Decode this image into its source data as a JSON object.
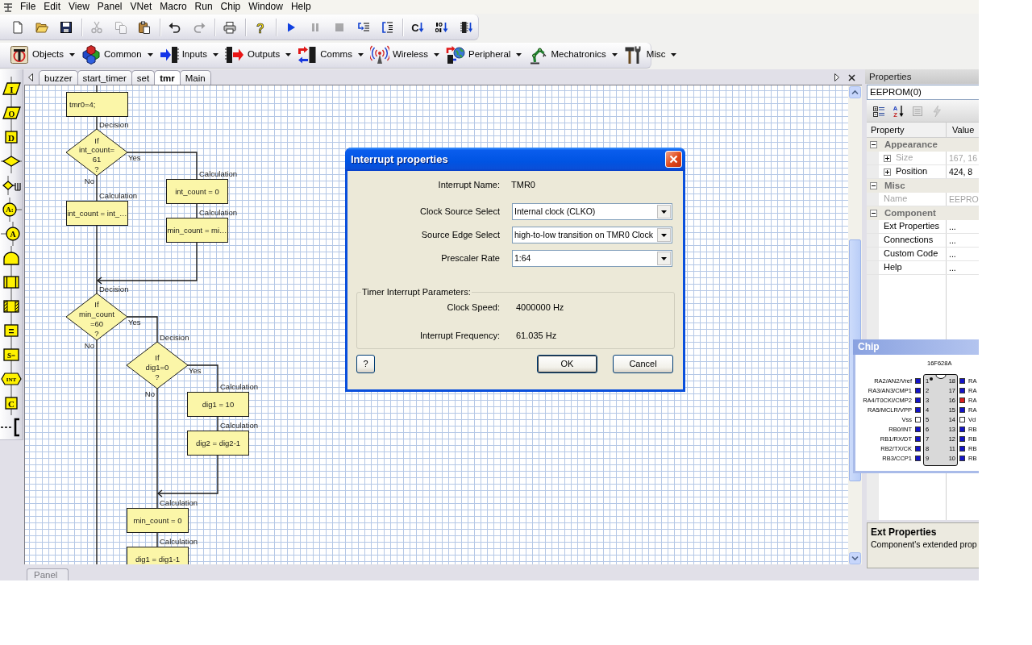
{
  "menu": [
    "File",
    "Edit",
    "View",
    "Panel",
    "VNet",
    "Macro",
    "Run",
    "Chip",
    "Window",
    "Help"
  ],
  "toolbar": [
    [
      {
        "kind": "new",
        "disabled": false
      },
      {
        "kind": "open",
        "disabled": false
      },
      {
        "kind": "save",
        "disabled": false
      }
    ],
    [
      {
        "kind": "cut",
        "disabled": true
      },
      {
        "kind": "copy",
        "disabled": true
      },
      {
        "kind": "paste",
        "disabled": false
      }
    ],
    [
      {
        "kind": "undo",
        "disabled": false
      },
      {
        "kind": "redo",
        "disabled": true
      }
    ],
    [
      {
        "kind": "print",
        "disabled": false
      }
    ],
    [
      {
        "kind": "help",
        "symbol": "?",
        "disabled": false
      }
    ],
    [
      {
        "kind": "run",
        "disabled": false
      },
      {
        "kind": "pause",
        "disabled": true
      },
      {
        "kind": "stop",
        "disabled": true
      },
      {
        "kind": "step_into",
        "disabled": false
      },
      {
        "kind": "step_over",
        "disabled": false
      }
    ],
    [
      {
        "kind": "compile_c",
        "symbol": "C",
        "disabled": false
      },
      {
        "kind": "compile_hex",
        "disabled": false
      },
      {
        "kind": "compile_chip",
        "disabled": false
      }
    ]
  ],
  "component_toolbar": [
    {
      "kind": "objects",
      "label": "Objects"
    },
    {
      "kind": "common",
      "label": "Common"
    },
    {
      "kind": "inputs",
      "label": "Inputs"
    },
    {
      "kind": "outputs",
      "label": "Outputs"
    },
    {
      "kind": "comms",
      "label": "Comms"
    },
    {
      "kind": "wireless",
      "label": "Wireless"
    },
    {
      "kind": "peripheral",
      "label": "Peripheral"
    },
    {
      "kind": "mechatronics",
      "label": "Mechatronics"
    },
    {
      "kind": "misc",
      "label": "Misc"
    }
  ],
  "palette": [
    {
      "kind": "input",
      "symbol": "I"
    },
    {
      "kind": "output",
      "symbol": "O"
    },
    {
      "kind": "delay",
      "symbol": "D"
    },
    {
      "kind": "decision"
    },
    {
      "kind": "switch"
    },
    {
      "kind": "connection_point",
      "symbol": "A:"
    },
    {
      "kind": "goto",
      "symbol": "A"
    },
    {
      "kind": "loop"
    },
    {
      "kind": "macro"
    },
    {
      "kind": "component_macro"
    },
    {
      "kind": "calculation",
      "symbol": "="
    },
    {
      "kind": "string",
      "symbol": "S="
    },
    {
      "kind": "interrupt",
      "symbol": "INT"
    },
    {
      "kind": "c_code",
      "symbol": "C"
    },
    {
      "kind": "comment"
    }
  ],
  "tabs": [
    {
      "label": "buzzer",
      "selected": false
    },
    {
      "label": "start_timer",
      "selected": false
    },
    {
      "label": "set",
      "selected": false
    },
    {
      "label": "tmr",
      "selected": true
    },
    {
      "label": "Main",
      "selected": false
    }
  ],
  "flowchart": [
    {
      "kind": "c_code",
      "text": "tmr0=4;"
    },
    {
      "kind": "decision",
      "caption": "Decision",
      "lines": [
        "If",
        "int_count=",
        "61",
        "?"
      ],
      "yes_label": "Yes",
      "no_label": "No",
      "yes": [
        {
          "kind": "calculation",
          "caption": "Calculation",
          "text": "int_count = 0"
        },
        {
          "kind": "calculation",
          "caption": "Calculation",
          "text": "min_count = mi…"
        }
      ],
      "no": [
        {
          "kind": "calculation",
          "caption": "Calculation",
          "text": "int_count = int_…"
        }
      ]
    },
    {
      "kind": "decision",
      "caption": "Decision",
      "lines": [
        "If",
        "min_count",
        "=60",
        "?"
      ],
      "yes_label": "Yes",
      "no_label": "No",
      "yes": [
        {
          "kind": "decision",
          "caption": "Decision",
          "lines": [
            "If",
            "dig1=0",
            "?"
          ],
          "yes_label": "Yes",
          "no_label": "No",
          "yes": [
            {
              "kind": "calculation",
              "caption": "Calculation",
              "text": "dig1 = 10"
            },
            {
              "kind": "calculation",
              "caption": "Calculation",
              "text": "dig2 = dig2-1"
            }
          ]
        },
        {
          "kind": "calculation",
          "caption": "Calculation",
          "text": "min_count = 0"
        },
        {
          "kind": "calculation",
          "caption": "Calculation",
          "text": "dig1 = dig1-1"
        }
      ]
    }
  ],
  "bottom_tabs": [
    {
      "label": "Panel",
      "selected": false
    }
  ],
  "dialog": {
    "title": "Interrupt properties",
    "name_label": "Interrupt Name:",
    "name_value": "TMR0",
    "selects": [
      {
        "label": "Clock Source Select",
        "value": "Internal clock (CLKO)"
      },
      {
        "label": "Source Edge Select",
        "value": "high-to-low transition on TMR0 Clock"
      },
      {
        "label": "Prescaler Rate",
        "value": "1:64"
      }
    ],
    "group": {
      "title": "Timer Interrupt Parameters:",
      "rows": [
        {
          "label": "Clock Speed:",
          "value": "4000000 Hz"
        },
        {
          "label": "Interrupt Frequency:",
          "value": "61.035 Hz"
        }
      ]
    },
    "help_button": "?",
    "buttons": [
      {
        "label": "OK",
        "default": true
      },
      {
        "label": "Cancel",
        "default": false
      }
    ]
  },
  "properties": {
    "title": "Properties",
    "object": "EEPROM(0)",
    "toolbar": [
      {
        "kind": "categorized",
        "disabled": false
      },
      {
        "kind": "alphabetical",
        "symbols": [
          "A",
          "Z"
        ],
        "disabled": false
      },
      {
        "kind": "property_pages",
        "disabled": true
      },
      {
        "kind": "events",
        "disabled": true
      }
    ],
    "columns": [
      "Property",
      "Value"
    ],
    "categories": [
      {
        "name": "Appearance",
        "expanded": true,
        "rows": [
          {
            "kind": "compound",
            "name": "Size",
            "value": "167, 16",
            "expanded": false,
            "disabled": true
          },
          {
            "kind": "compound",
            "name": "Position",
            "value": "424, 8",
            "expanded": false,
            "disabled": false
          }
        ]
      },
      {
        "name": "Misc",
        "expanded": true,
        "rows": [
          {
            "kind": "simple",
            "name": "Name",
            "value": "EEPRO",
            "disabled": true
          }
        ]
      },
      {
        "name": "Component",
        "expanded": true,
        "rows": [
          {
            "kind": "simple",
            "name": "Ext Properties",
            "value": "...",
            "disabled": false
          },
          {
            "kind": "simple",
            "name": "Connections",
            "value": "...",
            "disabled": false
          },
          {
            "kind": "simple",
            "name": "Custom Code",
            "value": "...",
            "disabled": false
          },
          {
            "kind": "simple",
            "name": "Help",
            "value": "...",
            "disabled": false
          }
        ]
      }
    ],
    "description": {
      "title": "Ext Properties",
      "text": "Component's extended prop"
    }
  },
  "chip": {
    "title": "Chip",
    "part": "16F628A",
    "left_pins": [
      {
        "number": "1",
        "label": "RA2/AN2/Vref",
        "color": "#1414c8"
      },
      {
        "number": "2",
        "label": "RA3/AN3/CMP1",
        "color": "#1414c8"
      },
      {
        "number": "3",
        "label": "RA4/T0CKI/CMP2",
        "color": "#1414c8"
      },
      {
        "number": "4",
        "label": "RA5/MCLR/VPP",
        "color": "#1414c8"
      },
      {
        "number": "5",
        "label": "Vss",
        "color": "#ffffff"
      },
      {
        "number": "6",
        "label": "RB0/INT",
        "color": "#1414c8"
      },
      {
        "number": "7",
        "label": "RB1/RX/DT",
        "color": "#1414c8"
      },
      {
        "number": "8",
        "label": "RB2/TX/CK",
        "color": "#1414c8"
      },
      {
        "number": "9",
        "label": "RB3/CCP1",
        "color": "#1414c8"
      }
    ],
    "right_pins": [
      {
        "number": "18",
        "label": "RA",
        "color": "#1414c8"
      },
      {
        "number": "17",
        "label": "RA",
        "color": "#1414c8"
      },
      {
        "number": "16",
        "label": "RA",
        "color": "#d81e1e"
      },
      {
        "number": "15",
        "label": "RA",
        "color": "#1414c8"
      },
      {
        "number": "14",
        "label": "Vd",
        "color": "#ffffff"
      },
      {
        "number": "13",
        "label": "RB",
        "color": "#1414c8"
      },
      {
        "number": "12",
        "label": "RB",
        "color": "#1414c8"
      },
      {
        "number": "11",
        "label": "RB",
        "color": "#1414c8"
      },
      {
        "number": "10",
        "label": "RB",
        "color": "#1414c8"
      }
    ]
  }
}
